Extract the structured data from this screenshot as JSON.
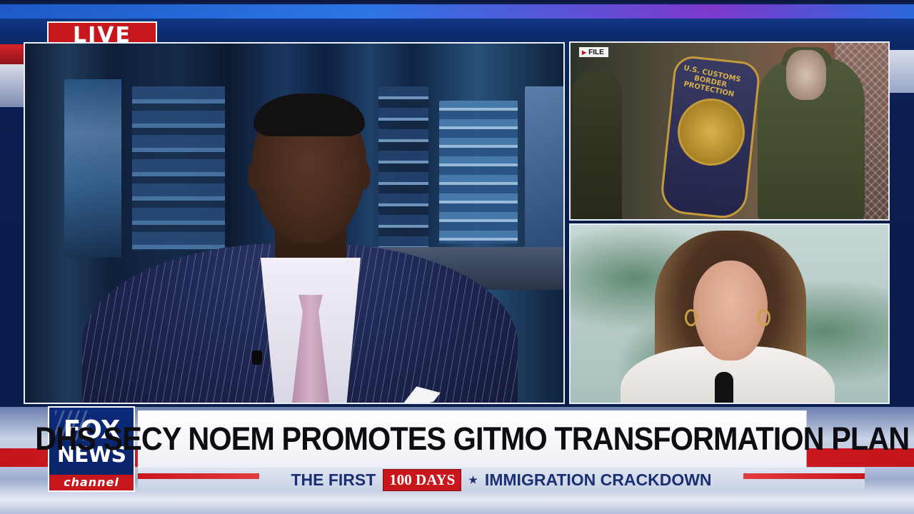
{
  "broadcast": {
    "live_label": "LIVE",
    "file_label": "FILE",
    "patch_text": "U.S. CUSTOMS BORDER PROTECTION"
  },
  "logo": {
    "line1": "FOX",
    "line2": "NEWS",
    "line3": "channel"
  },
  "lower_third": {
    "headline": "DHS SECY NOEM PROMOTES GITMO TRANSFORMATION PLAN",
    "ticker_left": "THE FIRST",
    "ticker_badge": "100 DAYS",
    "ticker_separator": "★",
    "ticker_right": "IMMIGRATION CRACKDOWN"
  },
  "colors": {
    "accent_red": "#c8161d",
    "fox_blue": "#0a2264",
    "frame_border": "#e9eef8"
  },
  "icons": {
    "file_tag_icon": "play-icon"
  }
}
